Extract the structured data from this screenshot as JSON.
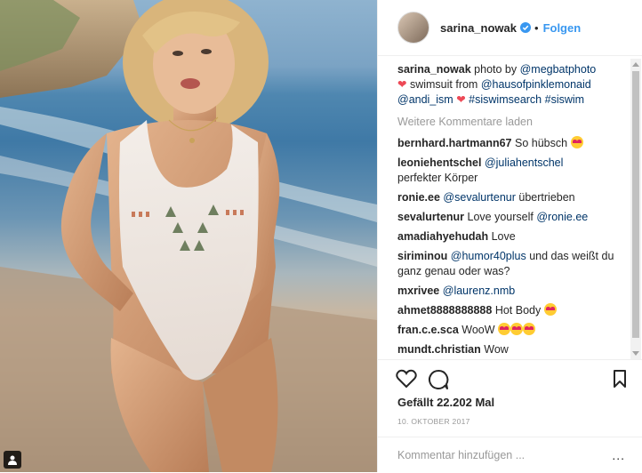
{
  "post": {
    "username": "sarina_nowak",
    "follow_label": "Folgen",
    "separator": "•",
    "caption": {
      "author": "sarina_nowak",
      "text_1": " photo by ",
      "mention_1": "@megbatphoto",
      "text_2": " swimsuit from ",
      "mention_2": "@hausofpinklemonaid",
      "mention_3": "@andi_ism",
      "hashtag_1": "#siswimsearch",
      "hashtag_2": "#siswim"
    },
    "load_more_label": "Weitere Kommentare laden",
    "comments": [
      {
        "user": "bernhard.hartmann67",
        "text": "So hübsch"
      },
      {
        "user": "leoniehentschel",
        "mention": "@juliahentschel",
        "text": "perfekter Körper"
      },
      {
        "user": "ronie.ee",
        "mention": "@sevalurtenur",
        "text": "übertrieben"
      },
      {
        "user": "sevalurtenur",
        "text": "Love yourself",
        "mention": "@ronie.ee"
      },
      {
        "user": "amadiahyehudah",
        "text": "Love"
      },
      {
        "user": "siriminou",
        "mention": "@humor40plus",
        "text": "und das weißt du ganz genau oder was?"
      },
      {
        "user": "mxrivee",
        "mention": "@laurenz.nmb"
      },
      {
        "user": "ahmet8888888888",
        "text": "Hot Body"
      },
      {
        "user": "fran.c.e.sca",
        "text": "WooW"
      },
      {
        "user": "mundt.christian",
        "text": "Wow"
      }
    ],
    "likes_label": "Gefällt 22.202 Mal",
    "date": "10. OKTOBER 2017",
    "comment_placeholder": "Kommentar hinzufügen ...",
    "options_label": "..."
  },
  "colors": {
    "link": "#003569",
    "follow": "#3897f0",
    "heart": "#ed4956",
    "muted": "#999999"
  },
  "icons": [
    "verified-badge-icon",
    "heart-icon",
    "comment-icon",
    "bookmark-icon",
    "user-tag-icon",
    "emoji-heart-eyes-icon"
  ]
}
